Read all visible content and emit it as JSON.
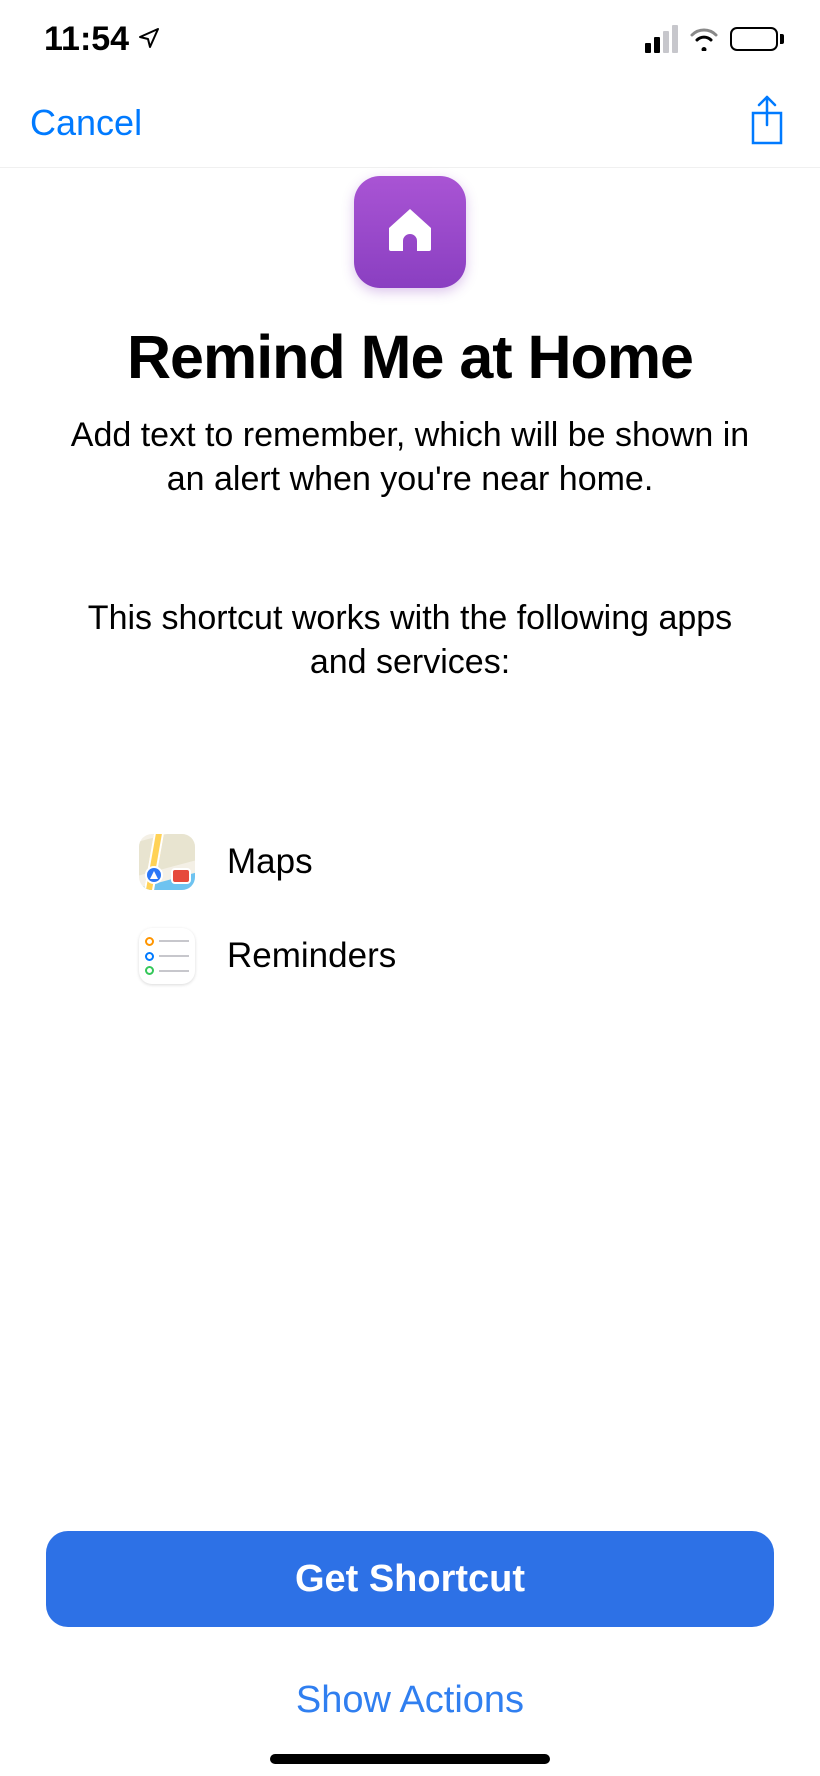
{
  "status_bar": {
    "time": "11:54"
  },
  "nav": {
    "cancel_label": "Cancel"
  },
  "shortcut": {
    "title": "Remind Me at Home",
    "description": "Add text to remember, which will be shown in an alert when you're near home.",
    "works_with_label": "This shortcut works with the following apps and services:",
    "apps": [
      {
        "name": "Maps",
        "icon": "maps-icon"
      },
      {
        "name": "Reminders",
        "icon": "reminders-icon"
      }
    ]
  },
  "actions": {
    "get_label": "Get Shortcut",
    "show_actions_label": "Show Actions"
  }
}
